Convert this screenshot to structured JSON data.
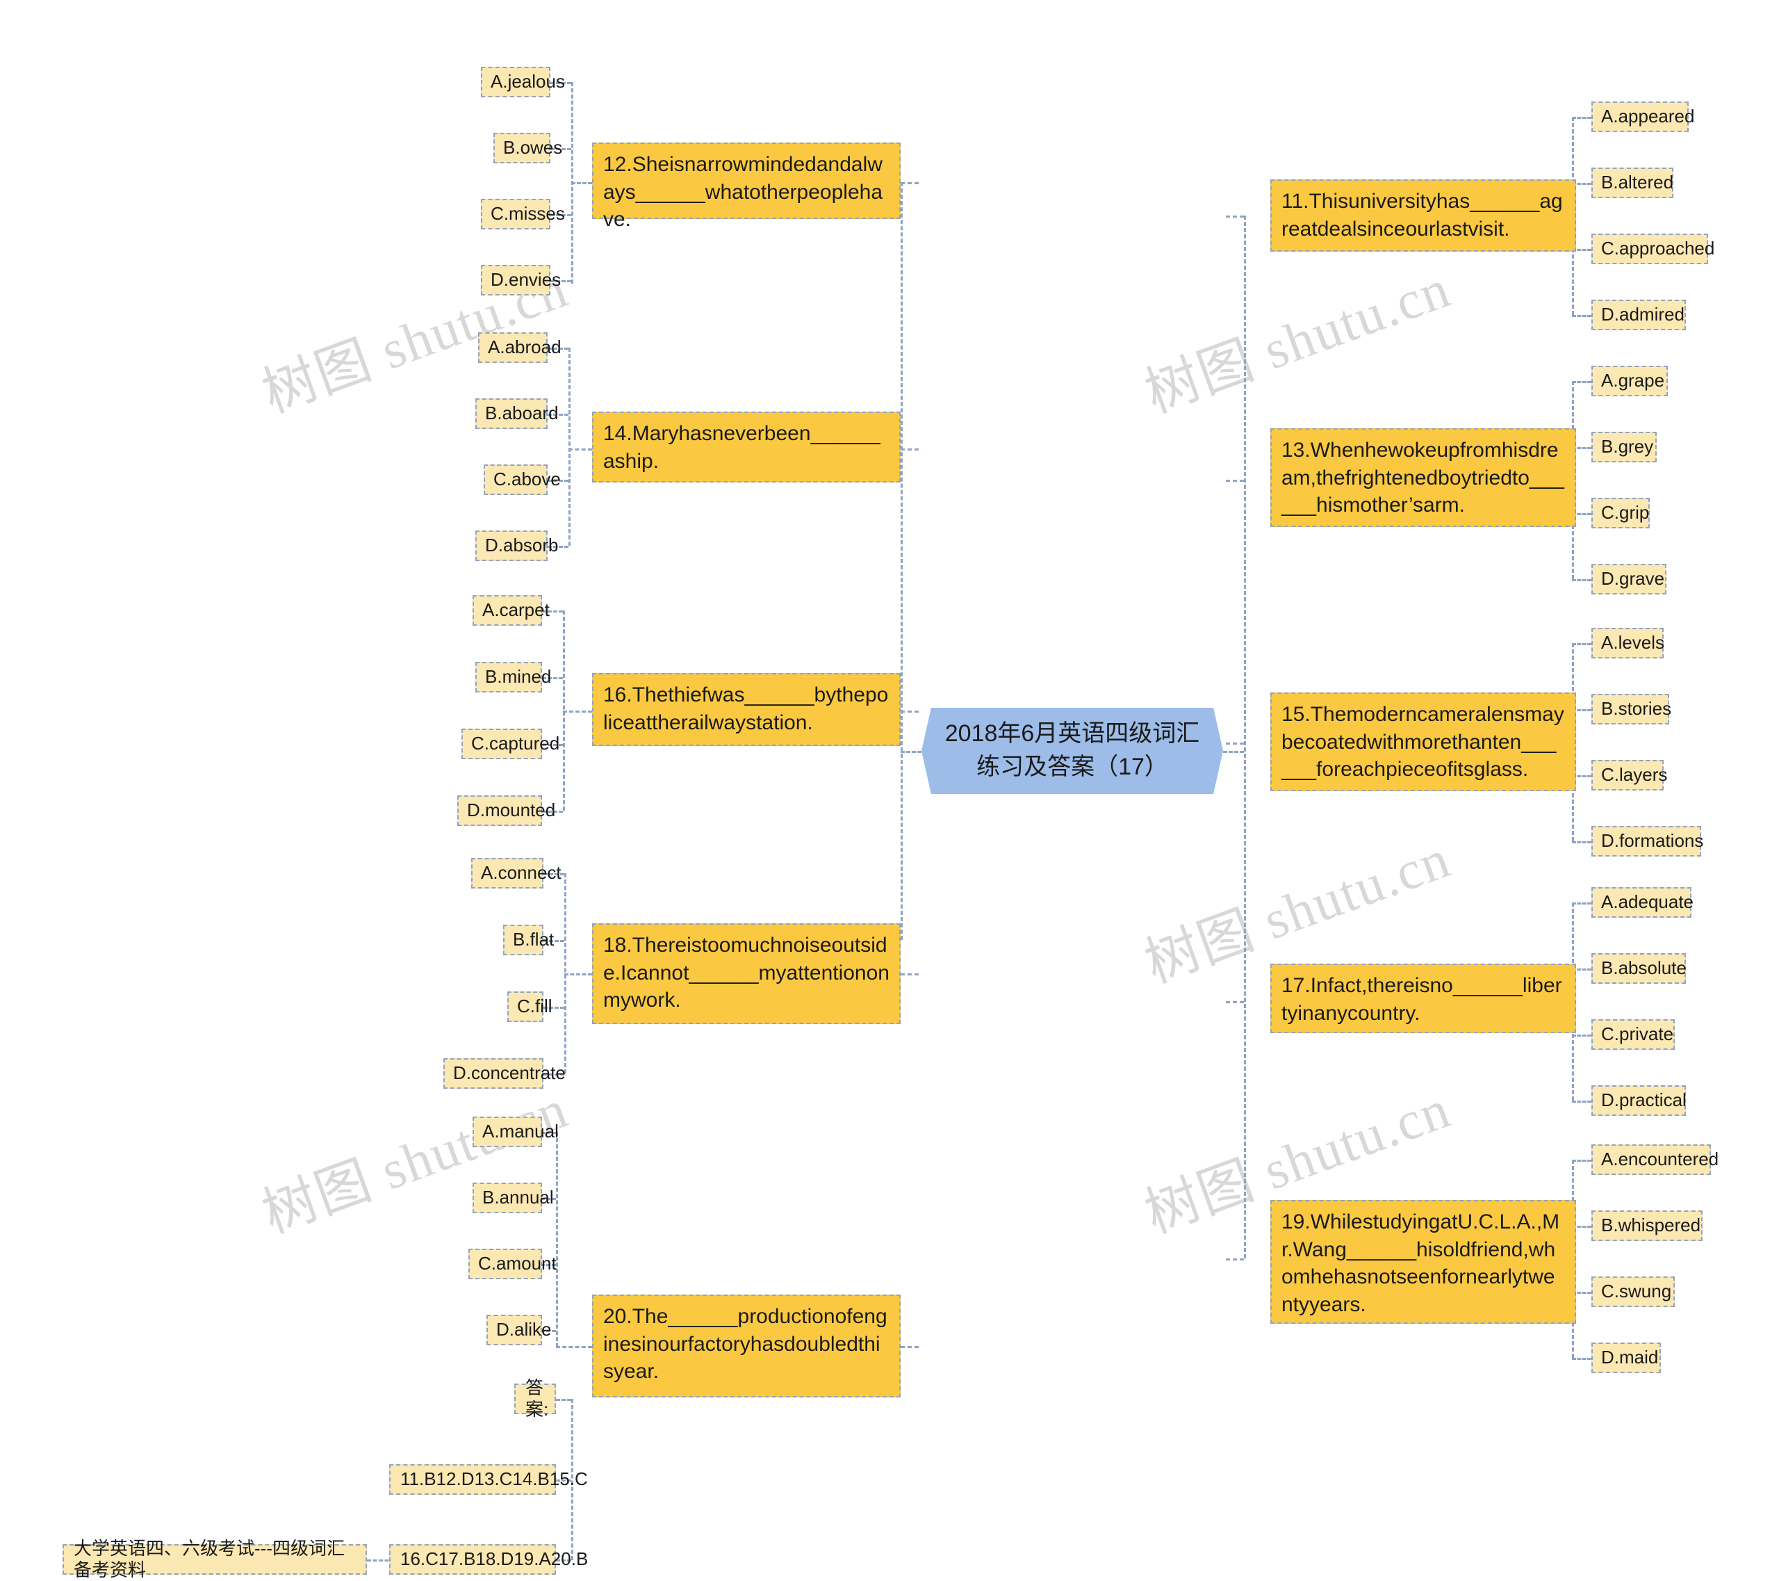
{
  "root": {
    "title_line1": "2018年6月英语四级词汇",
    "title_line2": "练习及答案（17）",
    "fill": "#9dbde8"
  },
  "watermark": {
    "text": "树图 shutu.cn",
    "color": "#d8d8d8"
  },
  "colors": {
    "question_fill": "#fbc941",
    "option_fill": "#fce8b2",
    "border": "#8fa4c4",
    "connector": "#8fa4c4"
  },
  "left_branches": [
    {
      "question": "12.Sheisnarrowmindedandalways______whatotherpeoplehave.",
      "options": [
        "A.jealous",
        "B.owes",
        "C.misses",
        "D.envies"
      ]
    },
    {
      "question": "14.Maryhasneverbeen______aship.",
      "options": [
        "A.abroad",
        "B.aboard",
        "C.above",
        "D.absorb"
      ]
    },
    {
      "question": "16.Thethiefwas______bythepoliceattherailwaystation.",
      "options": [
        "A.carpet",
        "B.mined",
        "C.captured",
        "D.mounted"
      ]
    },
    {
      "question": "18.Thereistoomuchnoiseoutside.Icannot______myattentiononmywork.",
      "options": [
        "A.connect",
        "B.flat",
        "C.fill",
        "D.concentrate"
      ]
    },
    {
      "question": "20.The______productionofenginesinourfactoryhasdoubledthisyear.",
      "options": [
        "A.manual",
        "B.annual",
        "C.amount",
        "D.alike"
      ]
    }
  ],
  "right_branches": [
    {
      "question": "11.Thisuniversityhas______agreatdealsinceourlastvisit.",
      "options": [
        "A.appeared",
        "B.altered",
        "C.approached",
        "D.admired"
      ]
    },
    {
      "question": "13.Whenhewokeupfromhisdream,thefrightenedboytriedto______hismother’sarm.",
      "options": [
        "A.grape",
        "B.grey",
        "C.grip",
        "D.grave"
      ]
    },
    {
      "question": "15.Themoderncameralensmaybecoatedwithmorethanten______foreachpieceofitsglass.",
      "options": [
        "A.levels",
        "B.stories",
        "C.layers",
        "D.formations"
      ]
    },
    {
      "question": "17.Infact,thereisno______libertyinanycountry.",
      "options": [
        "A.adequate",
        "B.absolute",
        "C.private",
        "D.practical"
      ]
    },
    {
      "question": "19.WhilestudyingatU.C.L.A.,Mr.Wang______hisoldfriend,whomhehasnotseenfornearlytwentyyears.",
      "options": [
        "A.encountered",
        "B.whispered",
        "C.swung",
        "D.maid"
      ]
    }
  ],
  "answers": {
    "label": "答案:",
    "line1": "11.B12.D13.C14.B15.C",
    "line2": "16.C17.B18.D19.A20.B",
    "source": "大学英语四、六级考试---四级词汇备考资料"
  }
}
